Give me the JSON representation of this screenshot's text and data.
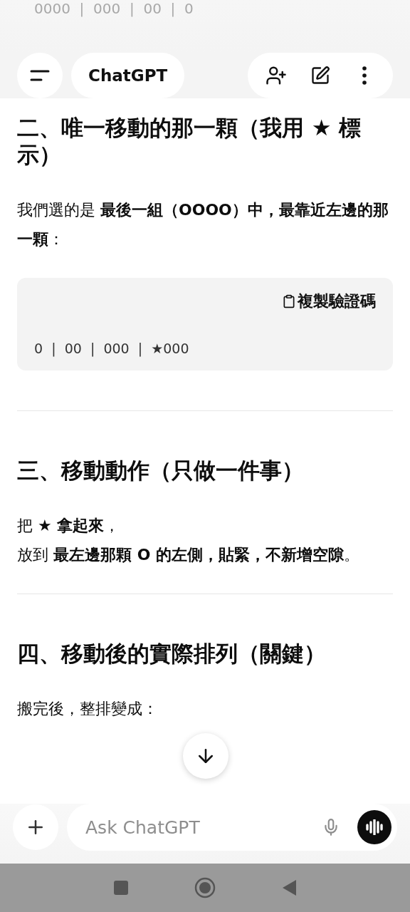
{
  "faded_code_line": "0000  |  000  |  00  |  0",
  "header": {
    "title": "ChatGPT"
  },
  "sections": [
    {
      "heading": "二、唯一移動的那一顆（我用 ★ 標示）",
      "paragraphs": [
        [
          "我們選的是 **最後一組（OOOO）中，最靠近左邊的那一顆**："
        ]
      ],
      "code_block": {
        "copy_label": "複製驗證碼",
        "code": "0  |  00  |  000  |  ★000"
      }
    },
    {
      "heading": "三、移動動作（只做一件事）",
      "paragraphs": [
        [
          "把 **★ 拿起來**，",
          "放到 **最左邊那顆 O 的左側，貼緊，不新增空隙**。"
        ]
      ]
    },
    {
      "heading": "四、移動後的實際排列（關鍵）",
      "paragraphs": [
        [
          "搬完後，整排變成："
        ]
      ]
    }
  ],
  "composer": {
    "placeholder": "Ask ChatGPT"
  }
}
